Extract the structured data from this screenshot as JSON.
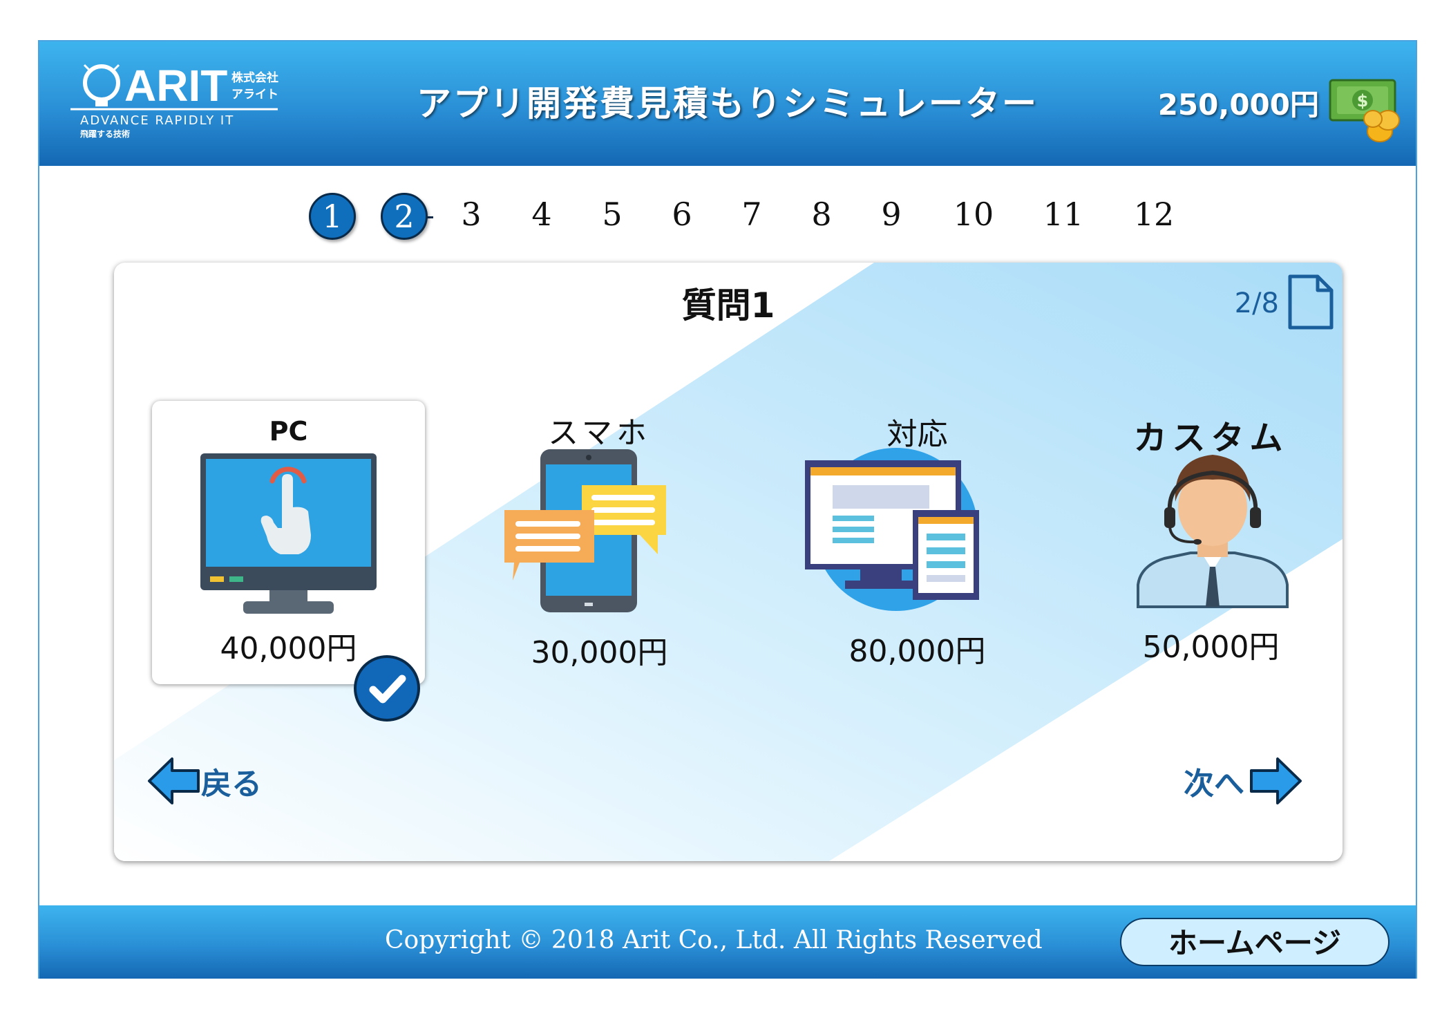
{
  "header": {
    "logo_text": "ARIT",
    "logo_company": "株式会社",
    "logo_kana": "アライト",
    "logo_tagline": "ADVANCE RAPIDLY IT",
    "logo_subtag": "飛躍する技術",
    "title": "アプリ開発費見積もりシミュレーター",
    "total": "250,000円",
    "money_icon": "money-icon"
  },
  "steps": [
    "1",
    "2",
    "3",
    "4",
    "5",
    "6",
    "7",
    "8",
    "9",
    "10",
    "11",
    "12"
  ],
  "active_steps": [
    "1",
    "2"
  ],
  "question": {
    "title": "質問1",
    "page_indicator": "2/8",
    "page_icon": "document-icon"
  },
  "options": [
    {
      "label": "PC",
      "price": "40,000円",
      "icon": "pc-icon",
      "selected": true
    },
    {
      "label": "スマホ",
      "price": "30,000円",
      "icon": "smartphone-icon",
      "selected": false
    },
    {
      "label": "対応",
      "price": "80,000円",
      "icon": "responsive-icon",
      "selected": false
    },
    {
      "label": "カスタム",
      "price": "50,000円",
      "icon": "custom-operator-icon",
      "selected": false
    }
  ],
  "nav": {
    "back_label": "戻る",
    "next_label": "次へ"
  },
  "footer": {
    "copyright": "Copyright © 2018 Arit Co., Ltd. All Rights Reserved",
    "home_label": "ホームページ"
  },
  "colors": {
    "header_top": "#3db4ee",
    "header_bottom": "#1467b3",
    "accent": "#0f6fbd",
    "link": "#1a5f9c",
    "panel_light_blue": "#bde6fb"
  }
}
